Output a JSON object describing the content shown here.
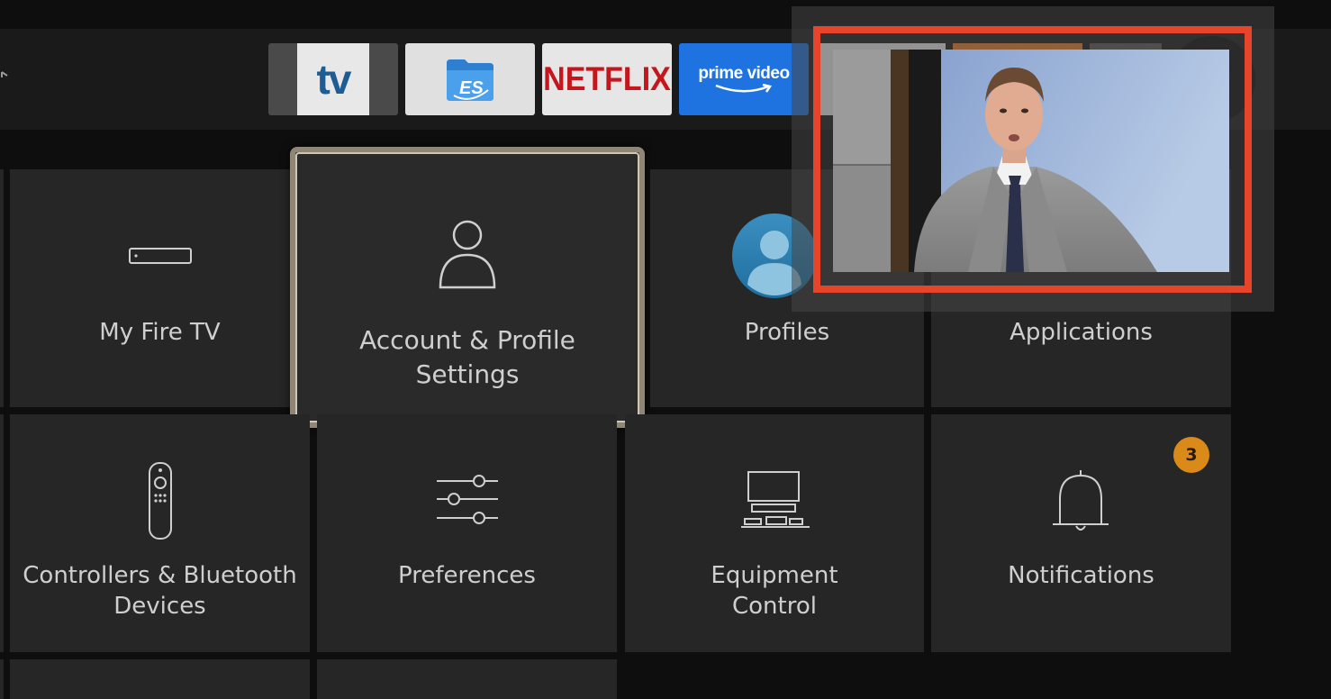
{
  "app_row": {
    "tv_label": "tv",
    "netflix_label": "NETFLIX",
    "prime_label": "prime video"
  },
  "settings": {
    "my_fire_tv": "My Fire TV",
    "account_line1": "Account & Profile",
    "account_line2": "Settings",
    "profiles": "Profiles",
    "applications": "Applications",
    "controllers_line1": "Controllers & Bluetooth",
    "controllers_line2": "Devices",
    "preferences": "Preferences",
    "equipment_line1": "Equipment",
    "equipment_line2": "Control",
    "notifications": "Notifications",
    "notifications_badge": "3"
  },
  "colors": {
    "pip_highlight": "#e8442a",
    "badge": "#d98a18",
    "prime_blue": "#1f73e0",
    "netflix_red": "#c4161c"
  },
  "icons": [
    "back-arrow-icon",
    "fire-tv-device-icon",
    "person-icon",
    "profile-avatar-icon",
    "remote-control-icon",
    "sliders-icon",
    "equipment-icon",
    "bell-icon",
    "es-file-explorer-icon"
  ]
}
